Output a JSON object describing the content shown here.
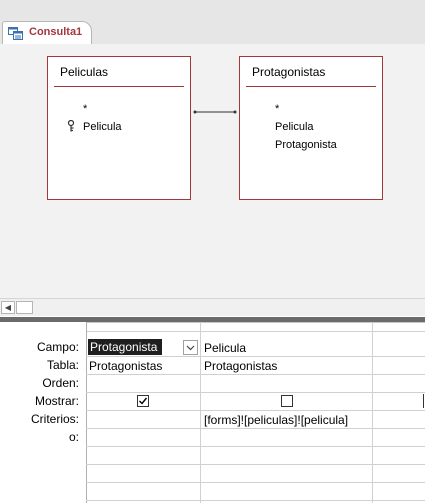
{
  "tab": {
    "label": "Consulta1",
    "icon": "query-icon"
  },
  "tables": [
    {
      "title": "Peliculas",
      "fields": [
        {
          "name": "*",
          "key": false
        },
        {
          "name": "Pelicula",
          "key": true
        }
      ]
    },
    {
      "title": "Protagonistas",
      "fields": [
        {
          "name": "*",
          "key": false
        },
        {
          "name": "Pelicula",
          "key": false
        },
        {
          "name": "Protagonista",
          "key": false
        }
      ]
    }
  ],
  "grid": {
    "row_labels": [
      "Campo:",
      "Tabla:",
      "Orden:",
      "Mostrar:",
      "Criterios:",
      "o:"
    ],
    "columns": [
      {
        "campo": "Protagonista",
        "tabla": "Protagonistas",
        "orden": "",
        "mostrar": true,
        "criterios": ""
      },
      {
        "campo": "Pelicula",
        "tabla": "Protagonistas",
        "orden": "",
        "mostrar": false,
        "criterios": "[forms]![peliculas]![pelicula]"
      }
    ]
  },
  "colors": {
    "accent": "#a4373a",
    "selection": "#1f1f1f",
    "splitter": "#6b6b6b"
  }
}
